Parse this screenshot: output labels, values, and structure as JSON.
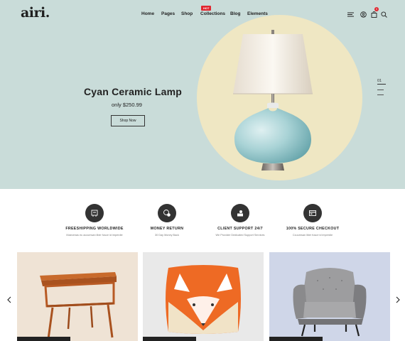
{
  "header": {
    "logo": "airi.",
    "nav": [
      "Home",
      "Pages",
      "Shop",
      "Collections",
      "Blog",
      "Elements"
    ],
    "active_nav": "Shop",
    "collections_badge": "HOT",
    "icons": [
      "menu-icon",
      "user-icon",
      "bag-icon",
      "search-icon"
    ],
    "cart_count": "0"
  },
  "hero": {
    "title": "Cyan Ceramic Lamp",
    "price": "only $250.99",
    "button": "Shop Now",
    "slide_number": "01"
  },
  "features": [
    {
      "icon": "truck-icon",
      "title": "FREESHIPPING WORLDWIDE",
      "subtitle": "Maecenas eu accumsan liber fusce id imperdie"
    },
    {
      "icon": "money-back-icon",
      "title": "MONEY RETURN",
      "subtitle": "30 Day Money Back"
    },
    {
      "icon": "support-icon",
      "title": "CLIENT SUPPORT 24/7",
      "subtitle": "We Provider Dedicated Support Services"
    },
    {
      "icon": "card-icon",
      "title": "100% SECURE CHECKOUT",
      "subtitle": "Ccuumsan liber fusce id imperdie"
    }
  ],
  "products": [
    {
      "item": "side-table",
      "bg": "#efe3d5"
    },
    {
      "item": "fox-pillow",
      "bg": "#e9e9e9"
    },
    {
      "item": "armchair",
      "bg": "#cfd6e8"
    }
  ],
  "colors": {
    "hero_bg": "#c9dcd9",
    "circle": "#efe7c3",
    "accent": "#e0262f",
    "dark": "#222222"
  }
}
